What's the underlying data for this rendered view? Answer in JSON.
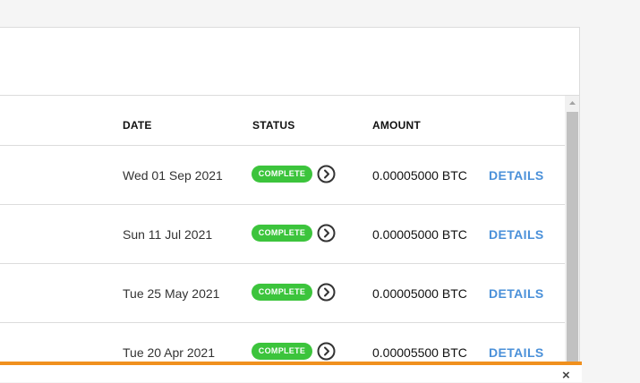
{
  "table": {
    "headers": {
      "date": "DATE",
      "status": "STATUS",
      "amount": "AMOUNT"
    },
    "rows": [
      {
        "date": "Wed 01 Sep 2021",
        "status": "COMPLETE",
        "amount": "0.00005000 BTC",
        "action": "DETAILS"
      },
      {
        "date": "Sun 11 Jul 2021",
        "status": "COMPLETE",
        "amount": "0.00005000 BTC",
        "action": "DETAILS"
      },
      {
        "date": "Tue 25 May 2021",
        "status": "COMPLETE",
        "amount": "0.00005000 BTC",
        "action": "DETAILS"
      },
      {
        "date": "Tue 20 Apr 2021",
        "status": "COMPLETE",
        "amount": "0.00005500 BTC",
        "action": "DETAILS"
      }
    ]
  },
  "footer": {
    "close_label": "×"
  },
  "colors": {
    "status_complete": "#3cc43c",
    "link": "#4a90d9",
    "accent_bar": "#f0901e"
  },
  "icons": {
    "row_action": "chevron-right-circle-icon",
    "scroll": "scroll-up-arrow-icon"
  }
}
